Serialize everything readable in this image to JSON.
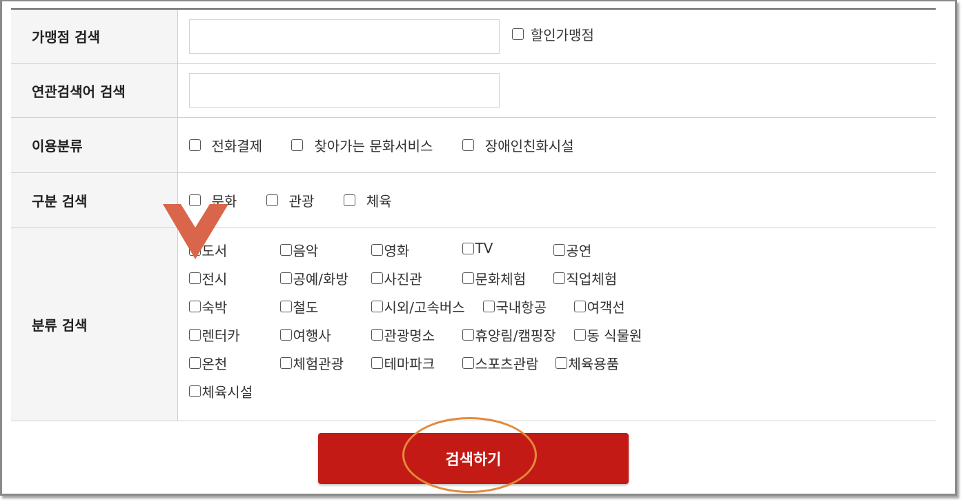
{
  "form": {
    "store_search": {
      "label": "가맹점 검색",
      "input_value": "",
      "discount_label": "할인가맹점"
    },
    "keyword_search": {
      "label": "연관검색어 검색",
      "input_value": ""
    },
    "usage": {
      "label": "이용분류",
      "options": [
        "전화결제",
        "찾아가는 문화서비스",
        "장애인친화시설"
      ]
    },
    "division": {
      "label": "구분 검색",
      "options": [
        "문화",
        "관광",
        "체육"
      ]
    },
    "category": {
      "label": "분류 검색",
      "options": [
        "도서",
        "음악",
        "영화",
        "TV",
        "공연",
        "전시",
        "공예/화방",
        "사진관",
        "문화체험",
        "직업체험",
        "숙박",
        "철도",
        "시외/고속버스",
        "국내항공",
        "여객선",
        "렌터카",
        "여행사",
        "관광명소",
        "휴양림/캠핑장",
        "동 식물원",
        "온천",
        "체험관광",
        "테마파크",
        "스포츠관람",
        "체육용품",
        "체육시설"
      ]
    }
  },
  "search_button": {
    "label": "검색하기"
  },
  "colors": {
    "button": "#c41a15",
    "annotation_circle": "#e48a3a",
    "annotation_arrow": "#d9664a"
  }
}
